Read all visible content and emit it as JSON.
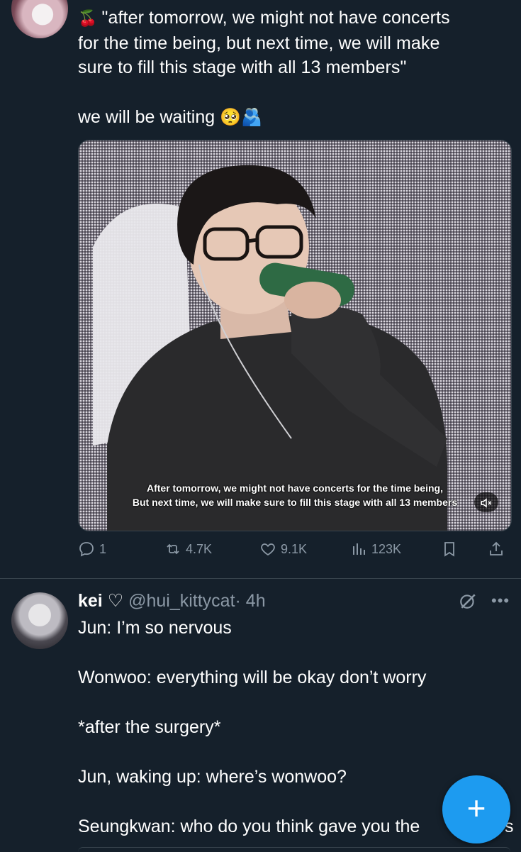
{
  "tweet1": {
    "cherry_emoji": "🍒",
    "text": "\"after tomorrow, we might not have concerts\nfor the time being, but next time, we will make\nsure to fill this stage with all 13 members\"",
    "waiting_text": "we will be waiting",
    "waiting_emojis": "🥺🫂",
    "video": {
      "subtitle_line1": "After tomorrow, we might not have concerts for the time being,",
      "subtitle_line2": "But next time, we will make sure to fill this stage with all 13 members",
      "mute_icon": "speaker-muted-icon"
    },
    "actions": {
      "replies": "1",
      "reposts": "4.7K",
      "likes": "9.1K",
      "views": "123K"
    }
  },
  "tweet2": {
    "display_name": "kei ♡",
    "handle": "@hui_kittycat",
    "time": "· 4h",
    "lines": [
      "Jun: I’m so nervous",
      "Wonwoo: everything will be okay don’t worry",
      "*after the surgery*",
      "Jun, waking up: where’s wonwoo?",
      "Seungkwan: who do you think gave you the"
    ],
    "trailing_char": "s"
  },
  "fab": {
    "label": "+"
  },
  "colors": {
    "bg": "#15202b",
    "muted": "#8b98a5",
    "accent": "#1d9bf0",
    "border": "#38444d"
  }
}
